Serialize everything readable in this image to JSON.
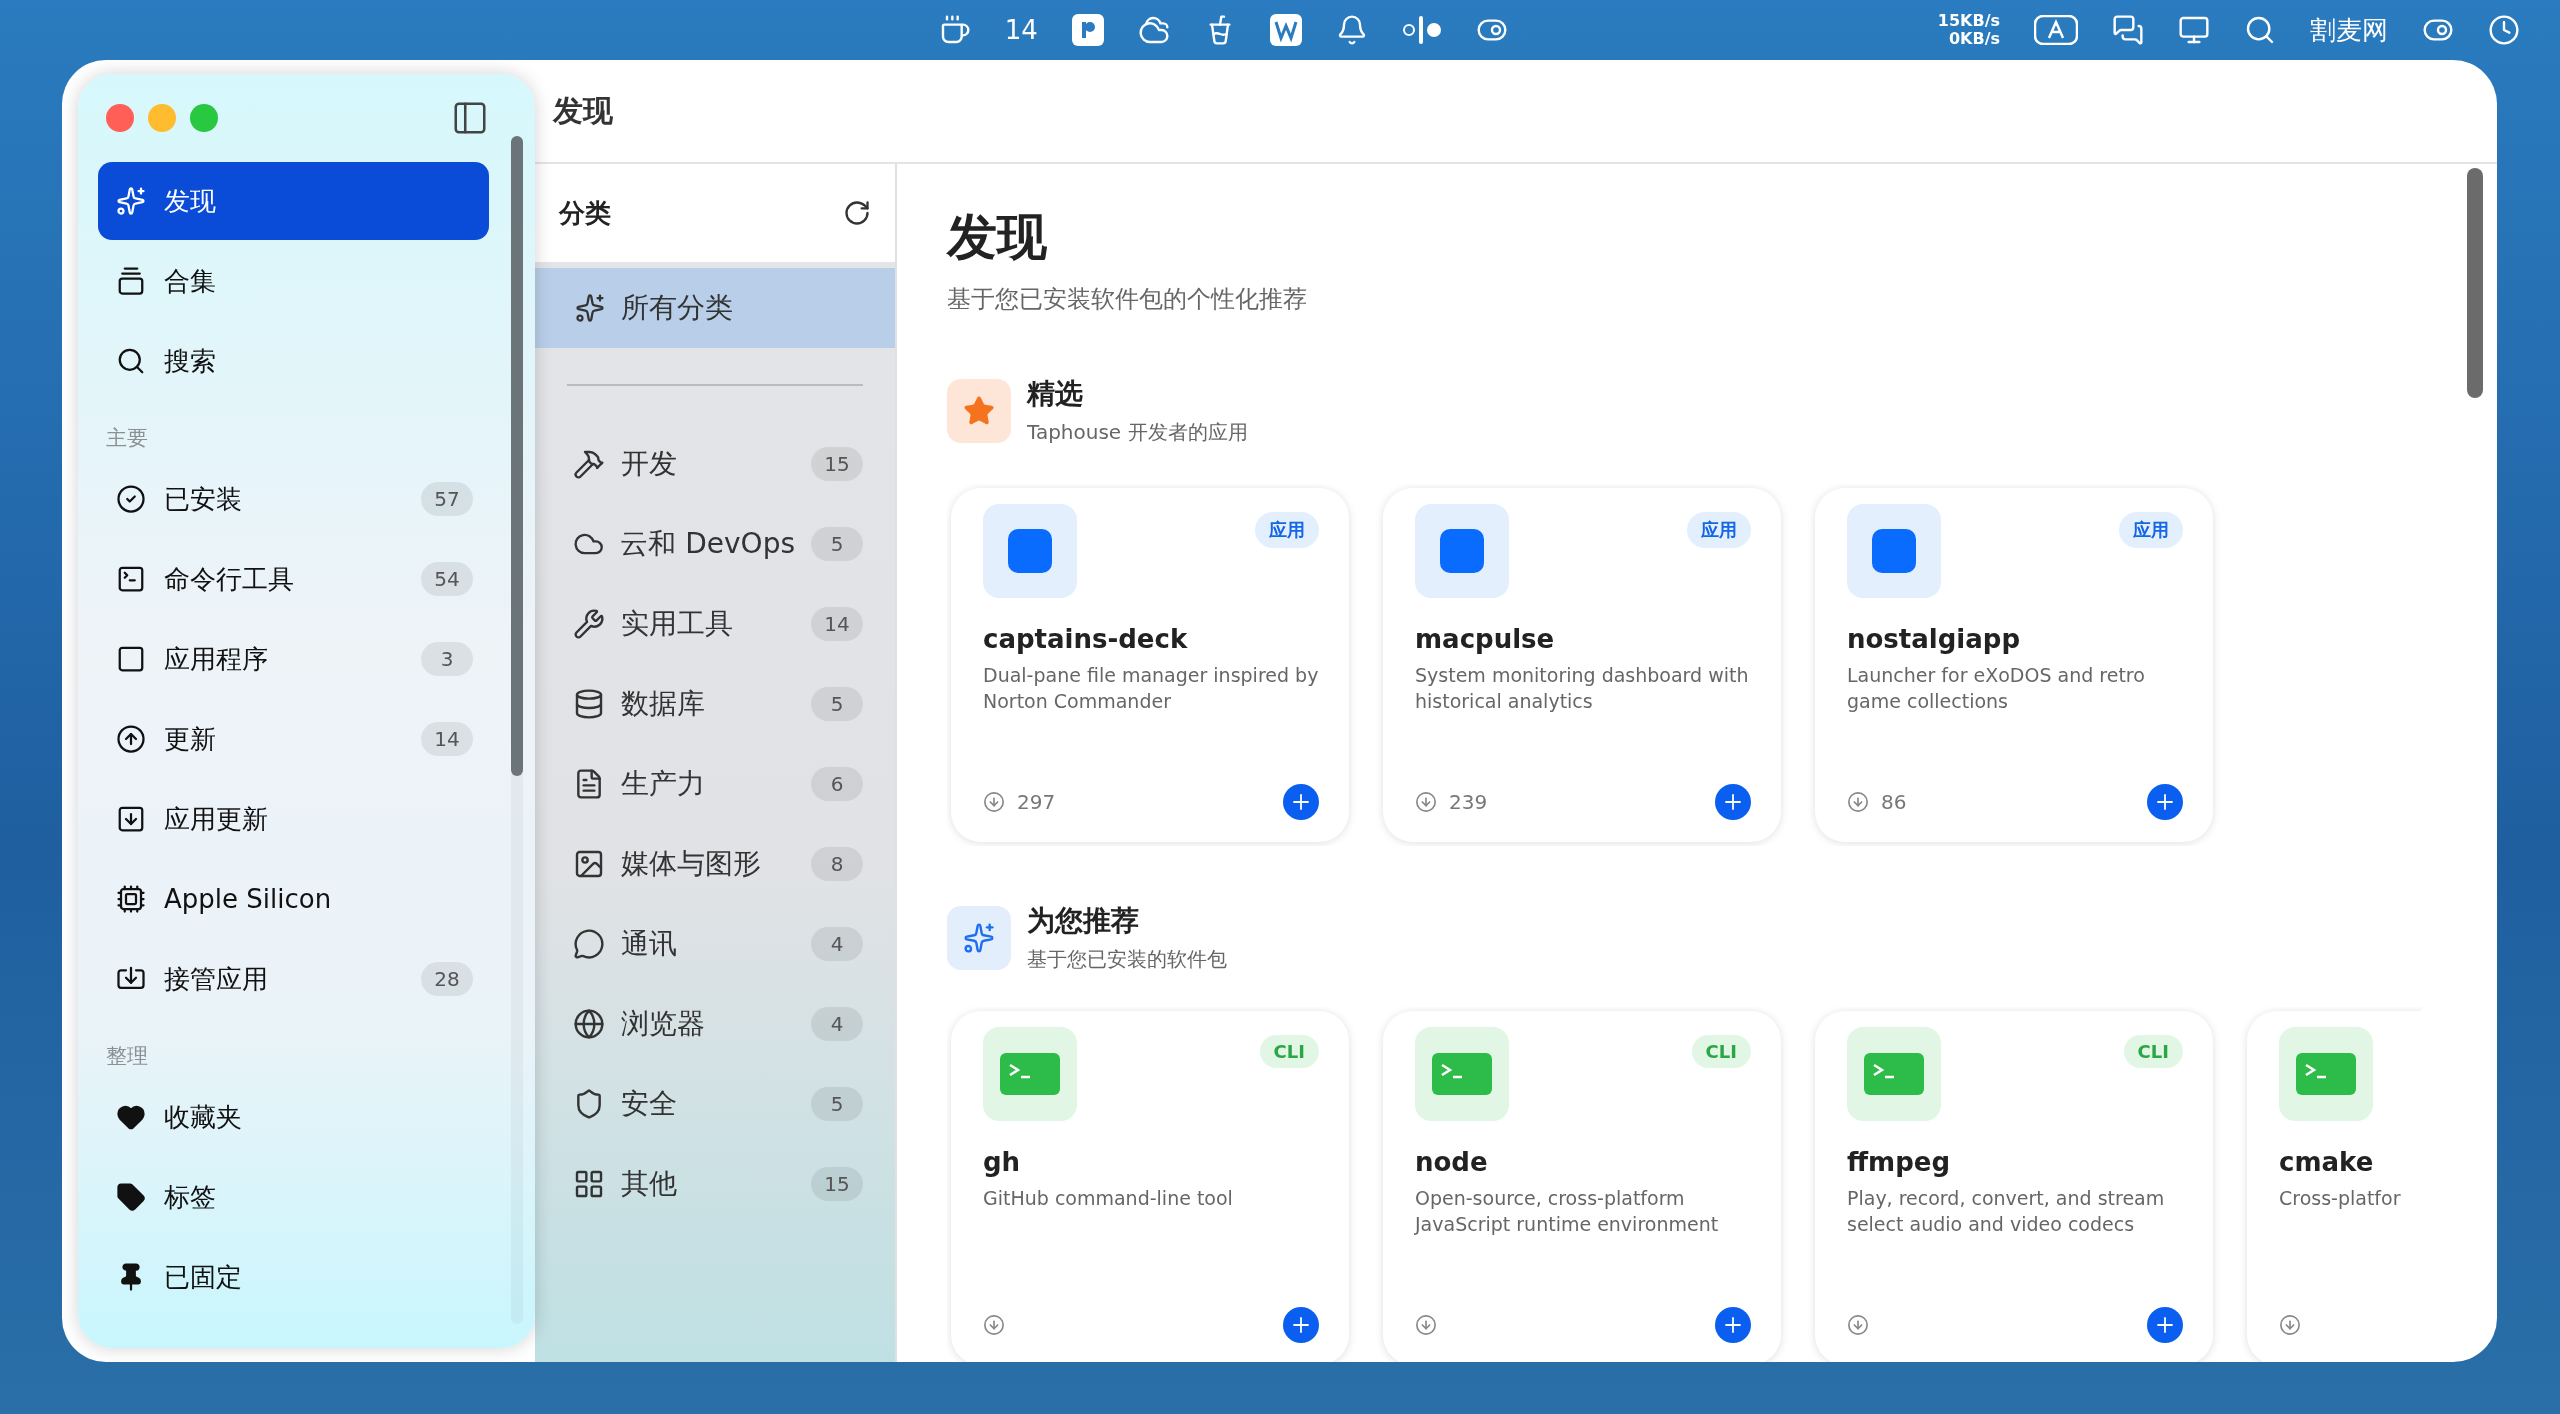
{
  "menu_bar": {
    "cup_count": "14",
    "net_up": "15KB/s",
    "net_down": "0KB/s",
    "site_name": "割麦网"
  },
  "window": {
    "title": "发现"
  },
  "sidebar": {
    "items": [
      {
        "label": "发现",
        "selected": true
      },
      {
        "label": "合集",
        "selected": false
      },
      {
        "label": "搜索",
        "selected": false
      }
    ],
    "sections": [
      {
        "title": "主要",
        "items": [
          {
            "label": "已安装",
            "count": "57",
            "selected": false
          },
          {
            "label": "命令行工具",
            "count": "54",
            "selected": false
          },
          {
            "label": "应用程序",
            "count": "3",
            "selected": false
          },
          {
            "label": "更新",
            "count": "14",
            "selected": false
          },
          {
            "label": "应用更新",
            "selected": false
          },
          {
            "label": "Apple Silicon",
            "selected": false
          },
          {
            "label": "接管应用",
            "count": "28",
            "selected": false
          }
        ]
      },
      {
        "title": "整理",
        "items": [
          {
            "label": "收藏夹",
            "selected": false
          },
          {
            "label": "标签",
            "selected": false
          },
          {
            "label": "已固定",
            "selected": false
          }
        ]
      }
    ]
  },
  "categories": {
    "title": "分类",
    "all": {
      "label": "所有分类",
      "selected": true
    },
    "items": [
      {
        "label": "开发",
        "count": "15",
        "selected": false
      },
      {
        "label": "云和 DevOps",
        "count": "5",
        "selected": false
      },
      {
        "label": "实用工具",
        "count": "14",
        "selected": false
      },
      {
        "label": "数据库",
        "count": "5",
        "selected": false
      },
      {
        "label": "生产力",
        "count": "6",
        "selected": false
      },
      {
        "label": "媒体与图形",
        "count": "8",
        "selected": false
      },
      {
        "label": "通讯",
        "count": "4",
        "selected": false
      },
      {
        "label": "浏览器",
        "count": "4",
        "selected": false
      },
      {
        "label": "安全",
        "count": "5",
        "selected": false
      },
      {
        "label": "其他",
        "count": "15",
        "selected": false
      }
    ]
  },
  "main": {
    "heading": "发现",
    "subtitle": "基于您已安装软件包的个性化推荐",
    "sections": [
      {
        "kind": "featured",
        "title": "精选",
        "subtitle": "Taphouse 开发者的应用",
        "cards": [
          {
            "kind": "app",
            "tag": "应用",
            "name": "captains-deck",
            "description": "Dual-pane file manager inspired by Norton Commander",
            "downloads": "297"
          },
          {
            "kind": "app",
            "tag": "应用",
            "name": "macpulse",
            "description": "System monitoring dashboard with historical analytics",
            "downloads": "239"
          },
          {
            "kind": "app",
            "tag": "应用",
            "name": "nostalgiapp",
            "description": "Launcher for eXoDOS and retro game collections",
            "downloads": "86"
          }
        ]
      },
      {
        "kind": "recommended",
        "title": "为您推荐",
        "subtitle": "基于您已安装的软件包",
        "cards": [
          {
            "kind": "cli",
            "tag": "CLI",
            "name": "gh",
            "description": "GitHub command-line tool"
          },
          {
            "kind": "cli",
            "tag": "CLI",
            "name": "node",
            "description": "Open-source, cross-platform JavaScript runtime environment"
          },
          {
            "kind": "cli",
            "tag": "CLI",
            "name": "ffmpeg",
            "description": "Play, record, convert, and stream select audio and video codecs"
          },
          {
            "kind": "cli",
            "name": "cmake",
            "description": "Cross-platfor"
          }
        ]
      }
    ]
  }
}
